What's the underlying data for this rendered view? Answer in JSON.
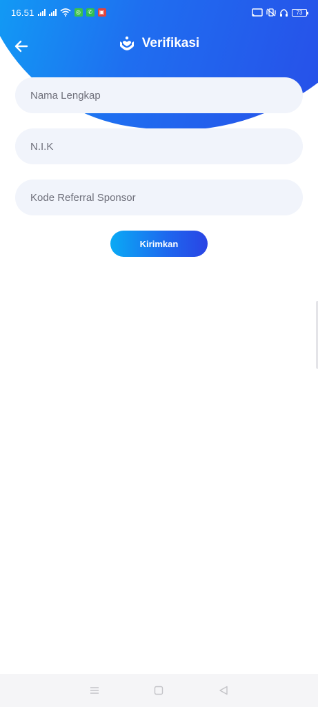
{
  "status_bar": {
    "time": "16.51",
    "battery": "73"
  },
  "app_bar": {
    "title": "Verifikasi"
  },
  "form": {
    "nama_placeholder": "Nama Lengkap",
    "nik_placeholder": "N.I.K",
    "referral_placeholder": "Kode Referral Sponsor",
    "submit_label": "Kirimkan"
  },
  "colors": {
    "gradient_start": "#0ab3f7",
    "gradient_end": "#2a45e6",
    "field_bg": "#f1f4fb"
  },
  "icons": {
    "back": "arrow-left-icon",
    "title": "hands-heart-icon"
  }
}
